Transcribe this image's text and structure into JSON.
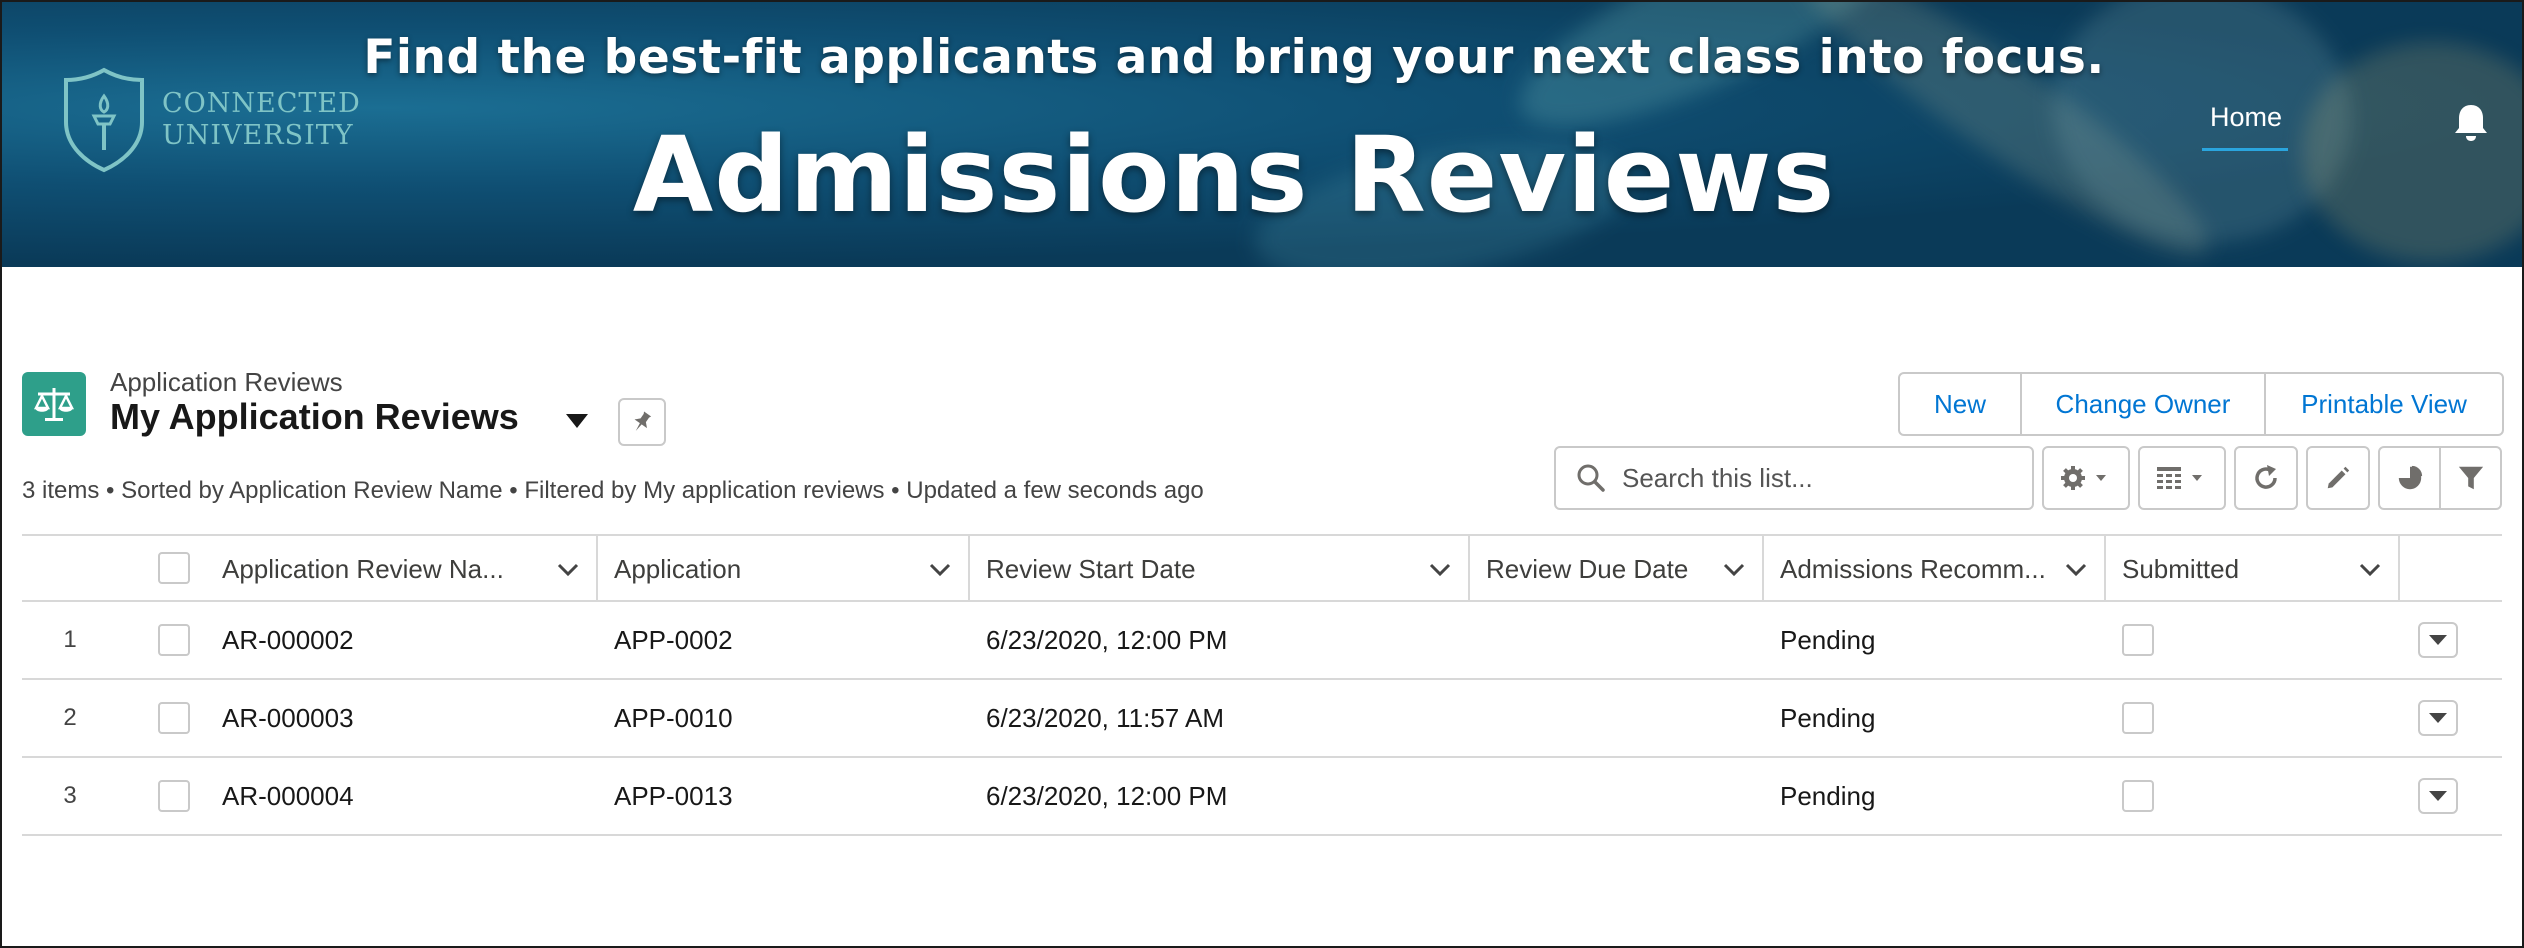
{
  "banner": {
    "logo_line1": "CONNECTED",
    "logo_line2": "UNIVERSITY",
    "tagline": "Find the best-fit applicants and bring your next class into focus.",
    "title": "Admissions Reviews",
    "nav_home": "Home",
    "bell_icon": "notification-bell-icon"
  },
  "list_header": {
    "object_label": "Application Reviews",
    "list_view_name": "My Application Reviews",
    "object_icon": "scales-icon",
    "summary": "3 items • Sorted by Application Review Name • Filtered by My application reviews • Updated a few seconds ago",
    "buttons": {
      "new": "New",
      "change_owner": "Change Owner",
      "printable_view": "Printable View"
    },
    "search_placeholder": "Search this list..."
  },
  "table": {
    "columns": [
      "Application Review Na...",
      "Application",
      "Review Start Date",
      "Review Due Date",
      "Admissions Recomm...",
      "Submitted"
    ],
    "rows": [
      {
        "num": "1",
        "name": "AR-000002",
        "application": "APP-0002",
        "start": "6/23/2020, 12:00 PM",
        "due": "",
        "recommendation": "Pending",
        "submitted": false
      },
      {
        "num": "2",
        "name": "AR-000003",
        "application": "APP-0010",
        "start": "6/23/2020, 11:57 AM",
        "due": "",
        "recommendation": "Pending",
        "submitted": false
      },
      {
        "num": "3",
        "name": "AR-000004",
        "application": "APP-0013",
        "start": "6/23/2020, 12:00 PM",
        "due": "",
        "recommendation": "Pending",
        "submitted": false
      }
    ]
  },
  "colors": {
    "brand_blue": "#0176d3",
    "object_icon_bg": "#2e9f8a",
    "banner_bg": "#0f4f73",
    "logo_teal": "#7fc4c6"
  }
}
